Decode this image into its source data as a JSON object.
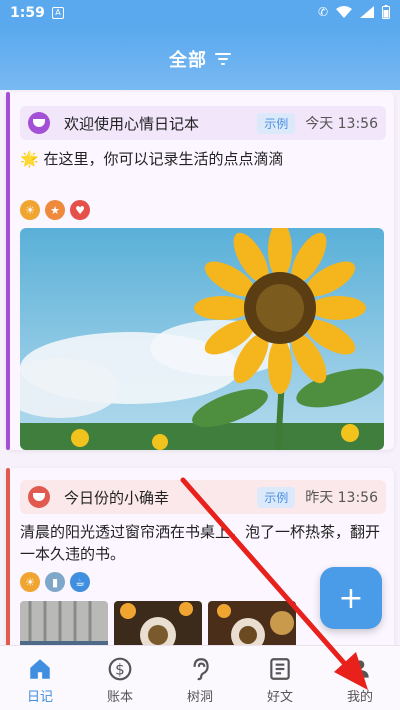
{
  "status": {
    "time": "1:59",
    "sim": "A"
  },
  "header": {
    "title": "全部"
  },
  "entries": [
    {
      "title": "欢迎使用心情日记本",
      "tag": "示例",
      "date": "今天 13:56",
      "text": "🌟 在这里，你可以记录生活的点点滴滴",
      "mood_color": "#a34fd6",
      "accent": "#a34fd6"
    },
    {
      "title": "今日份的小确幸",
      "tag": "示例",
      "date": "昨天 13:56",
      "text": "清晨的阳光透过窗帘洒在书桌上，泡了一杯热茶，翻开一本久违的书。",
      "mood_color": "#e05a4f",
      "accent": "#e05a4f"
    }
  ],
  "fab": {
    "label": "+"
  },
  "tabs": [
    {
      "label": "日记",
      "icon": "home-icon",
      "active": true
    },
    {
      "label": "账本",
      "icon": "dollar-icon",
      "active": false
    },
    {
      "label": "树洞",
      "icon": "ear-icon",
      "active": false
    },
    {
      "label": "好文",
      "icon": "article-icon",
      "active": false
    },
    {
      "label": "我的",
      "icon": "person-icon",
      "active": false
    }
  ]
}
